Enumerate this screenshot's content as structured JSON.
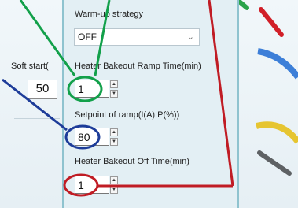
{
  "background": {
    "soft_start_label": "Soft start(",
    "soft_start_value": "50"
  },
  "popup": {
    "warmup": {
      "label": "Warm-up strategy",
      "selected": "OFF"
    },
    "ramp_time": {
      "label": "Heater Bakeout Ramp Time(min)",
      "value": "1"
    },
    "setpoint": {
      "label": "Setpoint of ramp(I(A) P(%))",
      "value": "80"
    },
    "off_time": {
      "label": "Heater Bakeout Off Time(min)",
      "value": "1"
    }
  },
  "icons": {
    "dropdown": "chevron-down-icon",
    "spin_up": "up-arrow-icon",
    "spin_down": "down-arrow-icon"
  },
  "colors": {
    "annotation_green": "#12a04a",
    "annotation_blue": "#1d3c99",
    "annotation_red": "#c01c24",
    "panel_border": "#8fc3cf",
    "gauge_red": "#d11f28",
    "gauge_blue": "#3d7fd8",
    "gauge_yellow": "#e6c531",
    "gauge_gray": "#5e6164",
    "gauge_green": "#2aa34a"
  }
}
